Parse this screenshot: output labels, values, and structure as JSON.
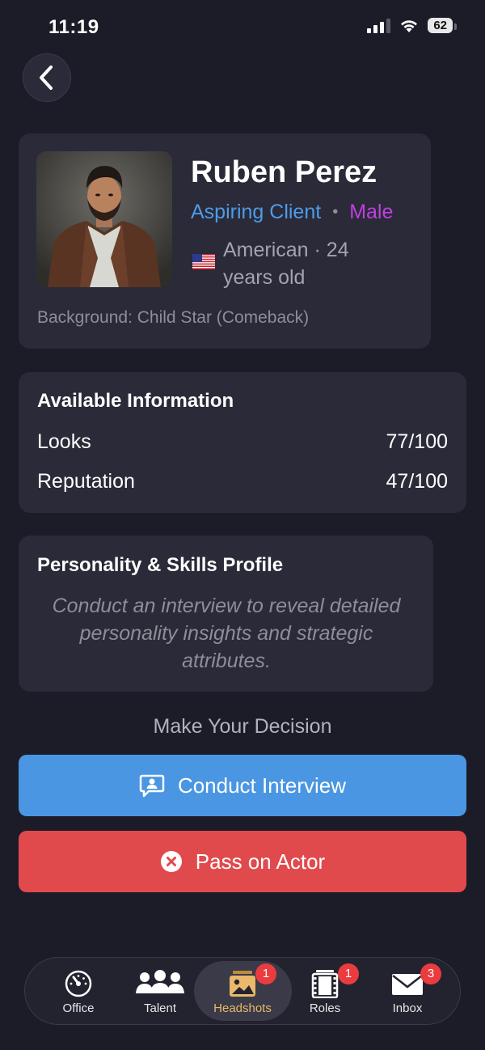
{
  "status_bar": {
    "time": "11:19",
    "battery": "62"
  },
  "profile": {
    "name": "Ruben Perez",
    "status": "Aspiring Client",
    "separator": "•",
    "gender": "Male",
    "origin": "American · 24 years old",
    "background": "Background: Child Star (Comeback)"
  },
  "info": {
    "title": "Available Information",
    "stats": [
      {
        "label": "Looks",
        "value": "77/100"
      },
      {
        "label": "Reputation",
        "value": "47/100"
      }
    ]
  },
  "personality": {
    "title": "Personality & Skills Profile",
    "text": "Conduct an interview to reveal detailed personality insights and strategic attributes."
  },
  "decision": {
    "heading": "Make Your Decision",
    "interview_label": "Conduct Interview",
    "pass_label": "Pass on Actor"
  },
  "tabs": [
    {
      "label": "Office",
      "icon": "gauge-icon",
      "badge": ""
    },
    {
      "label": "Talent",
      "icon": "people-icon",
      "badge": ""
    },
    {
      "label": "Headshots",
      "icon": "image-icon",
      "badge": "1"
    },
    {
      "label": "Roles",
      "icon": "film-icon",
      "badge": "1"
    },
    {
      "label": "Inbox",
      "icon": "envelope-icon",
      "badge": "3"
    }
  ],
  "colors": {
    "background": "#1c1c28",
    "card": "#2a2a38",
    "accent_blue": "#4a96e2",
    "danger_red": "#e14a4d",
    "gender_purple": "#c23fe0",
    "active_tab": "#e9b86a"
  }
}
